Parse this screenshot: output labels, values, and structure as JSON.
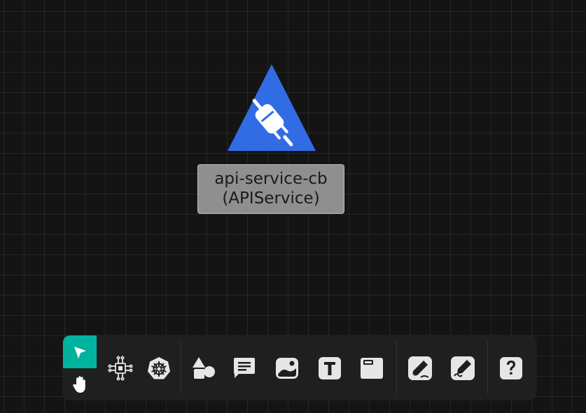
{
  "canvas": {
    "node": {
      "name": "api-service-cb",
      "kind": "(APIService)",
      "icon": "plug-icon",
      "shape_color": "#326ce5"
    }
  },
  "toolbar": {
    "accent_color": "#00b39f",
    "modes": [
      {
        "name": "select-mode",
        "icon": "cursor-arrow-icon",
        "active": true
      },
      {
        "name": "pan-mode",
        "icon": "hand-icon",
        "active": false
      }
    ],
    "tools": [
      {
        "name": "components",
        "icon": "component-chip-icon"
      },
      {
        "name": "kubernetes",
        "icon": "kubernetes-helm-icon"
      },
      {
        "name": "shapes",
        "icon": "shapes-icon"
      },
      {
        "name": "comment",
        "icon": "comment-icon"
      },
      {
        "name": "image",
        "icon": "image-icon"
      },
      {
        "name": "text",
        "icon": "text-icon",
        "glyph": "T"
      },
      {
        "name": "section",
        "icon": "section-icon"
      },
      {
        "name": "pen",
        "icon": "pen-icon"
      },
      {
        "name": "freehand",
        "icon": "freehand-pen-icon"
      },
      {
        "name": "help",
        "icon": "help-icon",
        "glyph": "?"
      }
    ]
  }
}
